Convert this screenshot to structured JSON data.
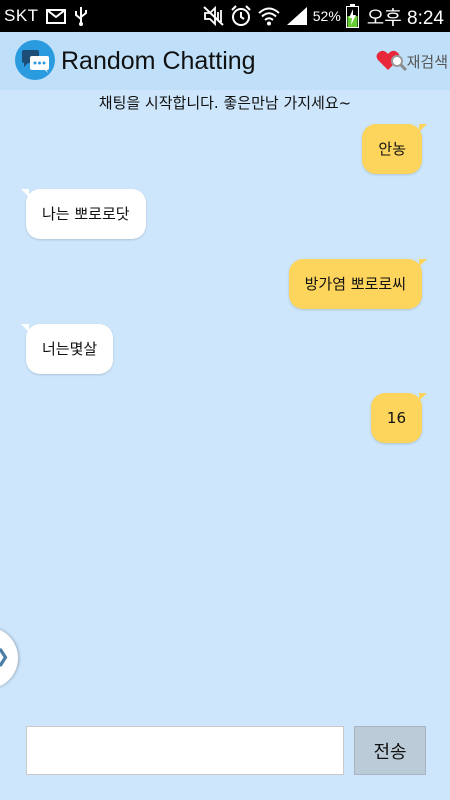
{
  "status_bar": {
    "carrier": "SKT",
    "battery_percent": "52%",
    "time": "오후 8:24",
    "icons": [
      "mail-icon",
      "usb-icon",
      "mute-icon",
      "alarm-icon",
      "wifi-icon",
      "signal-icon",
      "battery-charging-icon"
    ]
  },
  "header": {
    "title": "Random Chatting",
    "research_label": "재검색",
    "logo_icon": "chat-bubbles-icon",
    "research_icon": "heart-search-icon"
  },
  "chat": {
    "system_notice": "채팅을 시작합니다. 좋은만남 가지세요~",
    "messages": [
      {
        "sender": "me",
        "text": "안농"
      },
      {
        "sender": "other",
        "text": "나는 뽀로로닷"
      },
      {
        "sender": "me",
        "text": "방가염 뽀로로씨"
      },
      {
        "sender": "other",
        "text": "너는몇살"
      },
      {
        "sender": "me",
        "text": "16"
      }
    ]
  },
  "drawer": {
    "icon": "chevron-right-icon"
  },
  "composer": {
    "input_value": "",
    "send_label": "전송"
  },
  "colors": {
    "background": "#cde6fb",
    "header": "#bfe0f8",
    "my_bubble": "#fdd55c",
    "other_bubble": "#ffffff",
    "send_button": "#bccbd8"
  }
}
